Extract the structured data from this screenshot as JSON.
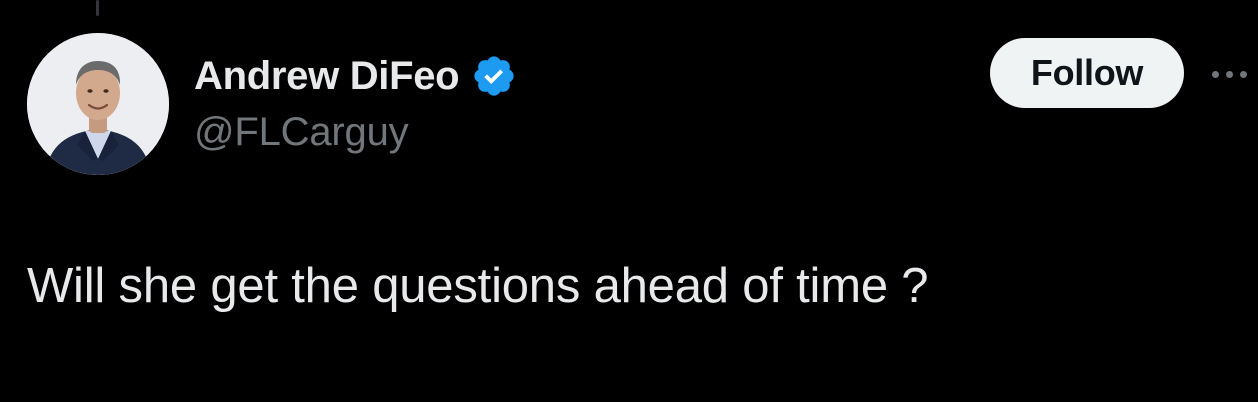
{
  "tweet": {
    "author": {
      "display_name": "Andrew DiFeo",
      "handle": "@FLCarguy",
      "verified": true,
      "avatar": "profile-photo"
    },
    "follow_label": "Follow",
    "more_icon": "more-horizontal-icon",
    "text": "Will she get the questions ahead of time ?"
  },
  "colors": {
    "background": "#000000",
    "primary_text": "#e7e9ea",
    "secondary_text": "#71767b",
    "verified_badge": "#1d9bf0",
    "follow_button_bg": "#eff3f4",
    "follow_button_text": "#0f1419"
  }
}
